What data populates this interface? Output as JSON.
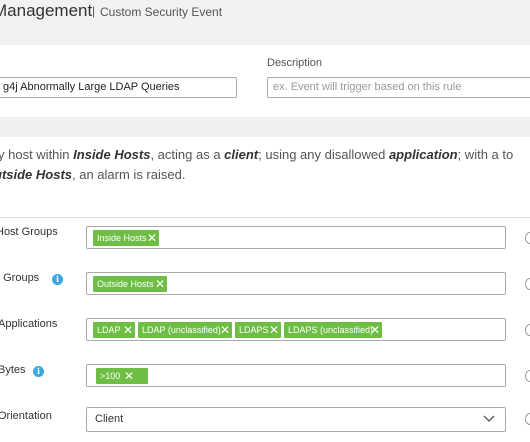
{
  "header": {
    "title": "Management",
    "separator": "|",
    "subtitle": "Custom Security Event"
  },
  "form": {
    "name_value": "g4j Abnormally Large LDAP Queries",
    "description_label": "Description",
    "description_placeholder": "ex. Event will trigger based on this rule"
  },
  "summary": {
    "line1_a": "y host within ",
    "line1_b": "Inside Hosts",
    "line1_c": ", acting as a ",
    "line1_d": "client",
    "line1_e": "; using any disallowed ",
    "line1_f": "application",
    "line1_g": "; with a to",
    "line2_a": "utside Hosts",
    "line2_b": ", an alarm is raised."
  },
  "rows": {
    "host_groups": {
      "label": "Host Groups",
      "chips": [
        "Inside Hosts"
      ]
    },
    "peer_groups": {
      "label": "t Groups",
      "chips": [
        "Outside Hosts"
      ]
    },
    "applications": {
      "label": "Applications",
      "chips": [
        "LDAP",
        "LDAP (unclassified)",
        "LDAPS",
        "LDAPS (unclassified)"
      ]
    },
    "bytes": {
      "label": "Bytes",
      "chips": [
        ">100"
      ]
    },
    "orientation": {
      "label": "Orientation",
      "value": "Client"
    }
  },
  "icons": {
    "chip_remove": "close-icon",
    "info": "info-icon",
    "dropdown": "chevron-down-icon"
  },
  "colors": {
    "chip_green": "#6ebe45",
    "info_blue": "#3aa7e0",
    "header_bg": "#f2f2f2"
  }
}
